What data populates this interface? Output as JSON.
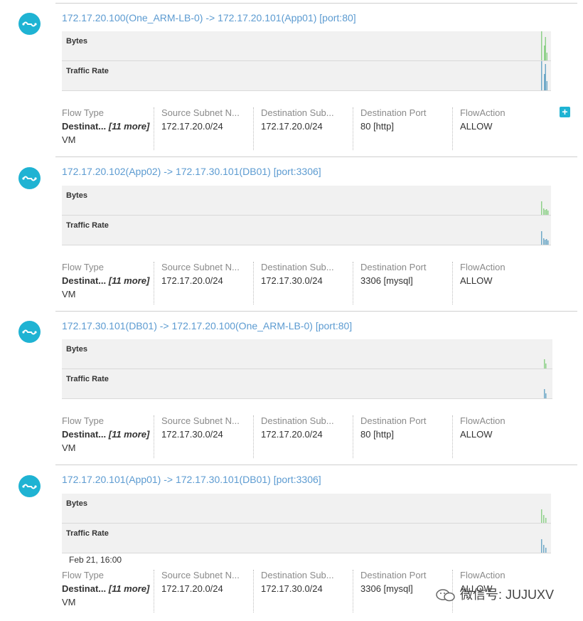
{
  "flows": [
    {
      "title": "172.17.20.100(One_ARM-LB-0) -> 172.17.20.101(App01) [port:80]",
      "lanes": [
        "Bytes",
        "Traffic Rate"
      ],
      "details": [
        {
          "header": "Flow Type",
          "value": "Destinat...",
          "more": "[11 more]",
          "extra": "VM"
        },
        {
          "header": "Source Subnet N...",
          "value": "172.17.20.0/24"
        },
        {
          "header": "Destination Sub...",
          "value": "172.17.20.0/24"
        },
        {
          "header": "Destination Port",
          "value": "80 [http]"
        },
        {
          "header": "FlowAction",
          "value": "ALLOW"
        }
      ]
    },
    {
      "title": "172.17.20.102(App02) -> 172.17.30.101(DB01) [port:3306]",
      "lanes": [
        "Bytes",
        "Traffic Rate"
      ],
      "details": [
        {
          "header": "Flow Type",
          "value": "Destinat...",
          "more": "[11 more]",
          "extra": "VM"
        },
        {
          "header": "Source Subnet N...",
          "value": "172.17.20.0/24"
        },
        {
          "header": "Destination Sub...",
          "value": "172.17.30.0/24"
        },
        {
          "header": "Destination Port",
          "value": "3306 [mysql]"
        },
        {
          "header": "FlowAction",
          "value": "ALLOW"
        }
      ]
    },
    {
      "title": "172.17.30.101(DB01) -> 172.17.20.100(One_ARM-LB-0) [port:80]",
      "lanes": [
        "Bytes",
        "Traffic Rate"
      ],
      "details": [
        {
          "header": "Flow Type",
          "value": "Destinat...",
          "more": "[11 more]",
          "extra": "VM"
        },
        {
          "header": "Source Subnet N...",
          "value": "172.17.30.0/24"
        },
        {
          "header": "Destination Sub...",
          "value": "172.17.20.0/24"
        },
        {
          "header": "Destination Port",
          "value": "80 [http]"
        },
        {
          "header": "FlowAction",
          "value": "ALLOW"
        }
      ]
    },
    {
      "title": "172.17.20.101(App01) -> 172.17.30.101(DB01) [port:3306]",
      "lanes": [
        "Bytes",
        "Traffic Rate"
      ],
      "details": [
        {
          "header": "Flow Type",
          "value": "Destinat...",
          "more": "[11 more]",
          "extra": "VM"
        },
        {
          "header": "Source Subnet N...",
          "value": "172.17.20.0/24"
        },
        {
          "header": "Destination Sub...",
          "value": "172.17.30.0/24"
        },
        {
          "header": "Destination Port",
          "value": "3306 [mysql]"
        },
        {
          "header": "FlowAction",
          "value": "ALLOW"
        }
      ]
    }
  ],
  "axis": {
    "time_label": "Feb 21, 16:00"
  },
  "expand_symbol": "+",
  "watermark": {
    "text": "微信号: JUJUXV"
  },
  "colors": {
    "accent": "#1fb3d3",
    "title_link": "#5c9bd1",
    "bytes_bars": "#8fd18a",
    "rate_bars": "#6fa9c8"
  }
}
